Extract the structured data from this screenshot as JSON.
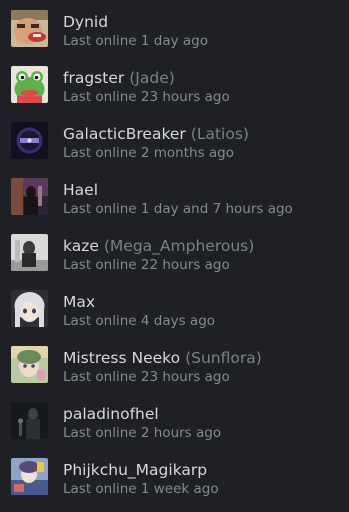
{
  "friends": [
    {
      "name": "Dynid",
      "nickname": "",
      "status": "Last online 1 day ago",
      "avatar": "cartoon-face-avatar"
    },
    {
      "name": "fragster",
      "nickname": "(Jade)",
      "status": "Last online 23 hours ago",
      "avatar": "frog-avatar"
    },
    {
      "name": "GalacticBreaker",
      "nickname": "(Latios)",
      "status": "Last online 2 months ago",
      "avatar": "purple-emblem-avatar"
    },
    {
      "name": "Hael",
      "nickname": "",
      "status": "Last online 1 day and 7 hours ago",
      "avatar": "dark-silhouette-avatar"
    },
    {
      "name": "kaze",
      "nickname": "(Mega_Ampherous)",
      "status": "Last online 22 hours ago",
      "avatar": "grey-figure-avatar"
    },
    {
      "name": "Max",
      "nickname": "",
      "status": "Last online 4 days ago",
      "avatar": "anime-girl-avatar"
    },
    {
      "name": "Mistress Neeko",
      "nickname": "(Sunflora)",
      "status": "Last online 23 hours ago",
      "avatar": "pastel-anime-avatar"
    },
    {
      "name": "paladinofhel",
      "nickname": "",
      "status": "Last online 2 hours ago",
      "avatar": "shadow-figure-avatar"
    },
    {
      "name": "Phijkchu_Magikarp",
      "nickname": "",
      "status": "Last online 1 week ago",
      "avatar": "colorful-art-avatar"
    }
  ]
}
